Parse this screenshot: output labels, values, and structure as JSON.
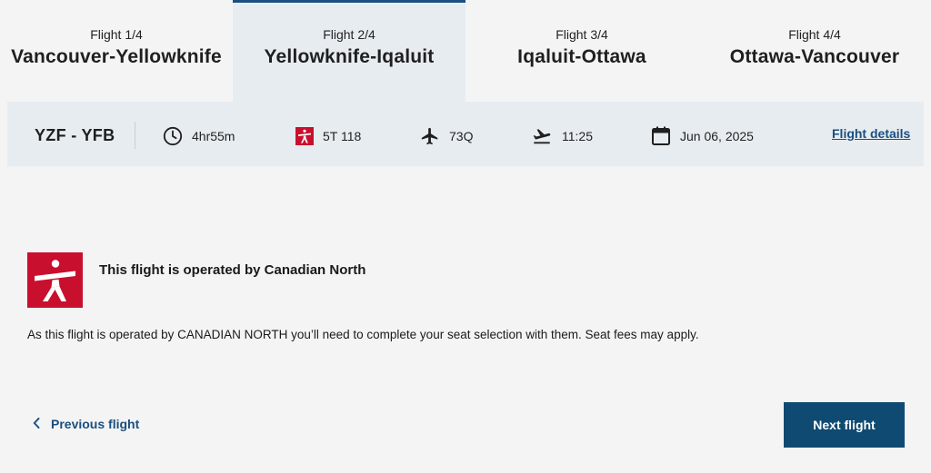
{
  "tabs": [
    {
      "num": "Flight 1/4",
      "route": "Vancouver-Yellowknife"
    },
    {
      "num": "Flight 2/4",
      "route": "Yellowknife-Iqaluit"
    },
    {
      "num": "Flight 3/4",
      "route": "Iqaluit-Ottawa"
    },
    {
      "num": "Flight 4/4",
      "route": "Ottawa-Vancouver"
    }
  ],
  "active_tab": 1,
  "flight_info": {
    "code": "YZF - YFB",
    "duration": "4hr55m",
    "flight_number": "5T 118",
    "aircraft": "73Q",
    "departure_time": "11:25",
    "date": "Jun 06, 2025",
    "details_link": "Flight details"
  },
  "icons": {
    "duration": "clock-icon",
    "flight_number": "canadian-north-logo-icon",
    "aircraft": "airplane-icon",
    "departure_time": "plane-departure-icon",
    "date": "calendar-icon"
  },
  "operator": {
    "title": "This flight is operated by Canadian North",
    "message": "As this flight is operated by CANADIAN NORTH you’ll need to complete your seat selection with them. Seat fees may apply."
  },
  "navigation": {
    "previous_label": "Previous flight",
    "next_label": "Next flight"
  },
  "colors": {
    "accent": "#1b4f80",
    "button": "#0f4a72",
    "operator_red": "#c8102e",
    "info_bar": "#e7ecf1"
  }
}
